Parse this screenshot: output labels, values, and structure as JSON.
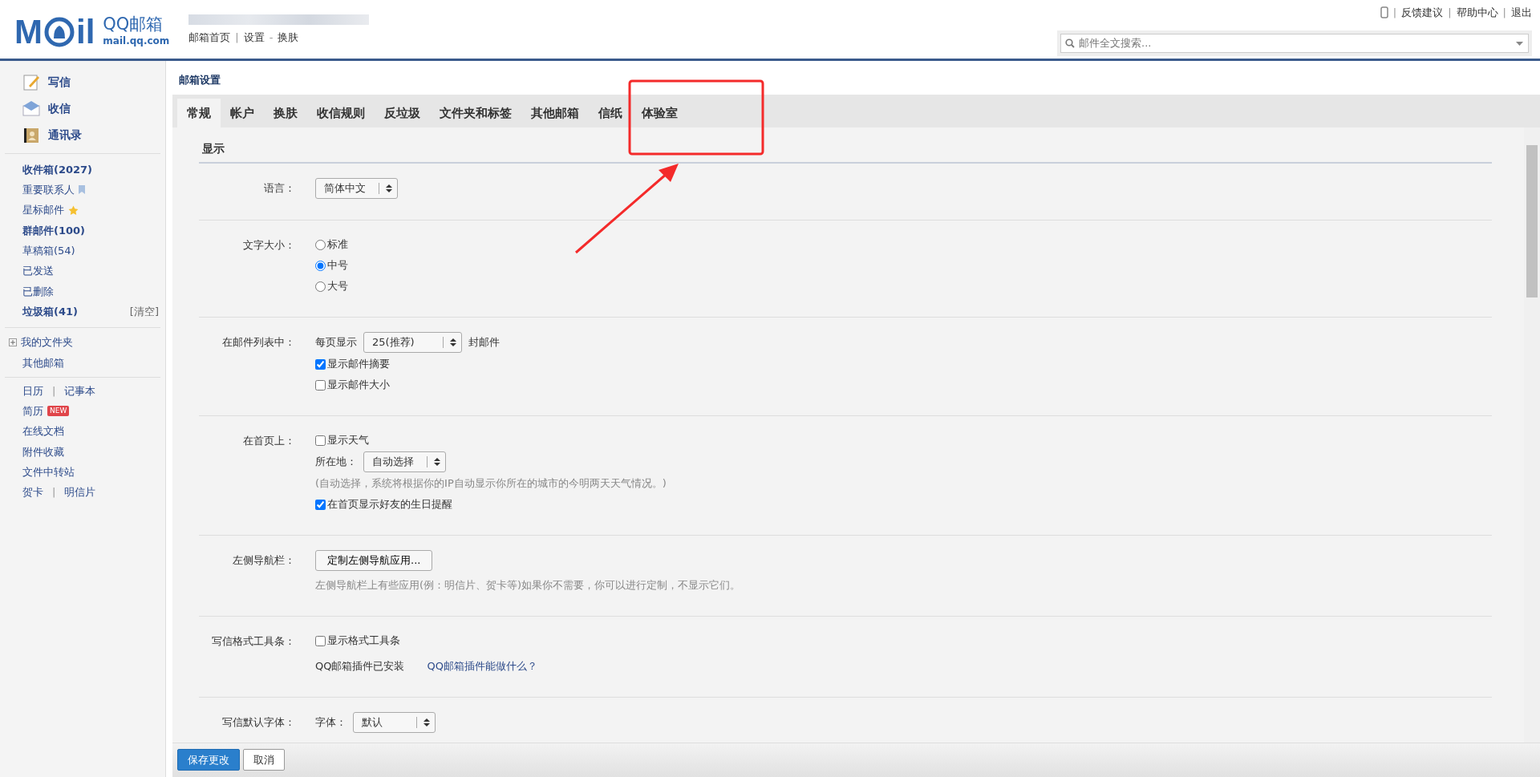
{
  "header": {
    "logo_letters": [
      "M",
      "il"
    ],
    "logo_name": "QQ邮箱",
    "logo_domain": "mail.qq.com",
    "nav": [
      {
        "label": "邮箱首页"
      },
      {
        "sep": "|",
        "label": "设置"
      },
      {
        "sep": "-",
        "label": "换肤"
      }
    ],
    "top_links": [
      {
        "sep": "|",
        "label": "反馈建议"
      },
      {
        "sep": "|",
        "label": "帮助中心"
      },
      {
        "sep": "|",
        "label": "退出"
      }
    ],
    "search": {
      "placeholder": "邮件全文搜索..."
    }
  },
  "sidebar": {
    "actions": [
      {
        "kind": "compose",
        "label": "写信"
      },
      {
        "kind": "inbox",
        "label": "收信"
      },
      {
        "kind": "contacts",
        "label": "通讯录"
      }
    ],
    "folders": [
      {
        "label": "收件箱(2027)",
        "bold": true
      },
      {
        "label": "重要联系人",
        "bold": false,
        "kind": "bookmark"
      },
      {
        "label": "星标邮件",
        "bold": false,
        "kind": "star"
      },
      {
        "label": "群邮件(100)",
        "bold": true
      },
      {
        "label": "草稿箱(54)",
        "bold": false
      },
      {
        "label": "已发送",
        "bold": false
      },
      {
        "label": "已删除",
        "bold": false
      },
      {
        "label": "垃圾箱(41)",
        "bold": true,
        "action": "[清空]"
      }
    ],
    "more": [
      {
        "label": "我的文件夹",
        "kind": "expander"
      },
      {
        "label": "其他邮箱"
      }
    ],
    "apps": [
      {
        "links": [
          "日历",
          "记事本"
        ],
        "sep": "|"
      },
      {
        "links": [
          "简历"
        ],
        "badge": "NEW"
      },
      {
        "links": [
          "在线文档"
        ]
      },
      {
        "links": [
          "附件收藏"
        ]
      },
      {
        "links": [
          "文件中转站"
        ]
      },
      {
        "links": [
          "贺卡",
          "明信片"
        ],
        "sep": "|"
      }
    ]
  },
  "settings": {
    "title": "邮箱设置",
    "tabs": [
      {
        "label": "常规",
        "selected": true
      },
      {
        "label": "帐户",
        "selected": false
      },
      {
        "label": "换肤",
        "selected": false
      },
      {
        "label": "收信规则",
        "selected": false
      },
      {
        "label": "反垃圾",
        "selected": false
      },
      {
        "label": "文件夹和标签",
        "selected": false
      },
      {
        "label": "其他邮箱",
        "selected": false
      },
      {
        "label": "信纸",
        "selected": false
      },
      {
        "label": "体验室",
        "selected": false
      }
    ],
    "section": "显示",
    "rows": [
      {
        "label": "语言：",
        "controls": [
          {
            "kind": "select",
            "value": "简体中文"
          }
        ]
      },
      {
        "label": "文字大小：",
        "controls": [
          {
            "kind": "radio",
            "label": "标准",
            "checked": false
          },
          {
            "kind": "radio",
            "label": "中号",
            "checked": true
          },
          {
            "kind": "radio",
            "label": "大号",
            "checked": false
          }
        ]
      },
      {
        "label": "在邮件列表中：",
        "controls": [
          {
            "kind": "select",
            "prefix": "每页显示",
            "value": "25(推荐)",
            "suffix": "封邮件"
          },
          {
            "kind": "checkbox",
            "label": "显示邮件摘要",
            "checked": true
          },
          {
            "kind": "checkbox",
            "label": "显示邮件大小",
            "checked": false
          }
        ]
      },
      {
        "label": "在首页上：",
        "controls": [
          {
            "kind": "checkbox",
            "label": "显示天气",
            "checked": false
          },
          {
            "kind": "select",
            "prefix": "所在地：",
            "value": "自动选择"
          },
          {
            "kind": "hint",
            "text": "(自动选择，系统将根据你的IP自动显示你所在的城市的今明两天天气情况。)"
          },
          {
            "kind": "checkbox",
            "label": "在首页显示好友的生日提醒",
            "checked": true
          }
        ]
      },
      {
        "label": "左侧导航栏：",
        "controls": [
          {
            "kind": "button",
            "label": "定制左侧导航应用..."
          },
          {
            "kind": "hint",
            "text": "左侧导航栏上有些应用(例：明信片、贺卡等)如果你不需要，你可以进行定制，不显示它们。"
          }
        ]
      },
      {
        "label": "写信格式工具条：",
        "controls": [
          {
            "kind": "checkbox",
            "label": "显示格式工具条",
            "checked": false
          },
          {
            "kind": "links",
            "text": "QQ邮箱插件已安装",
            "link": "QQ邮箱插件能做什么？"
          }
        ]
      },
      {
        "label": "写信默认字体：",
        "controls": [
          {
            "kind": "select",
            "prefix": "字体：",
            "value": "默认"
          }
        ]
      }
    ],
    "buttons": [
      {
        "label": "保存更改",
        "primary": true
      },
      {
        "label": "取消",
        "primary": false
      }
    ]
  }
}
